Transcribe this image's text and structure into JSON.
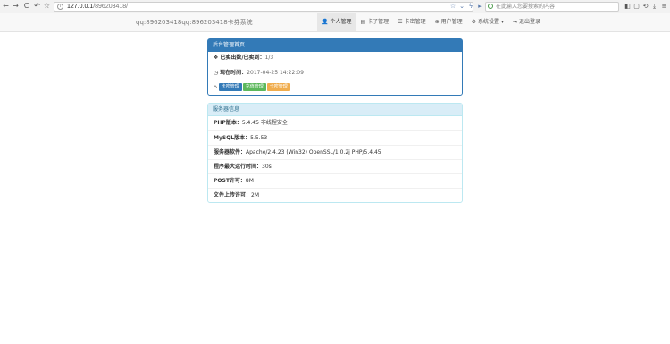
{
  "browser": {
    "url_host": "127.0.0.1",
    "url_path": "/896203418/",
    "search_placeholder": "在此输入您要搜索的内容",
    "back_icon": "←",
    "forward_icon": "→",
    "reload_icon": "C",
    "home_icon": "⌂",
    "undo_icon": "↶",
    "star_icon": "☆"
  },
  "nav": {
    "brand": "qq:896203418qq:896203418卡券系统",
    "items": [
      {
        "icon": "👤",
        "label": "个人管理"
      },
      {
        "icon": "▤",
        "label": "卡了管理"
      },
      {
        "icon": "☰",
        "label": "卡密管理"
      },
      {
        "icon": "⊕",
        "label": "用户管理"
      },
      {
        "icon": "⚙",
        "label": "系统设置 ▾"
      },
      {
        "icon": "⇥",
        "label": "退出登录"
      }
    ]
  },
  "panel1": {
    "title": "后台管理首页",
    "row1_label": "已卖出数/已卖到：",
    "row1_value": "1/3",
    "row2_label": "现在时间：",
    "row2_value": "2017-04-25 14:22:09",
    "buttons": [
      "卡密管理",
      "充值管理",
      "卡密管理"
    ],
    "colors": {
      "primary": "#337ab7",
      "green": "#5cb85c",
      "orange": "#f0ad4e"
    }
  },
  "panel2": {
    "title": "服务器信息",
    "rows": [
      {
        "label": "PHP版本：",
        "value": "5.4.45 非线程安全"
      },
      {
        "label": "MySQL版本：",
        "value": "5.5.53"
      },
      {
        "label": "服务器软件：",
        "value": "Apache/2.4.23 (Win32) OpenSSL/1.0.2j PHP/5.4.45"
      },
      {
        "label": "程序最大运行时间：",
        "value": "30s"
      },
      {
        "label": "POST许可：",
        "value": "8M"
      },
      {
        "label": "文件上传许可：",
        "value": "2M"
      }
    ]
  }
}
